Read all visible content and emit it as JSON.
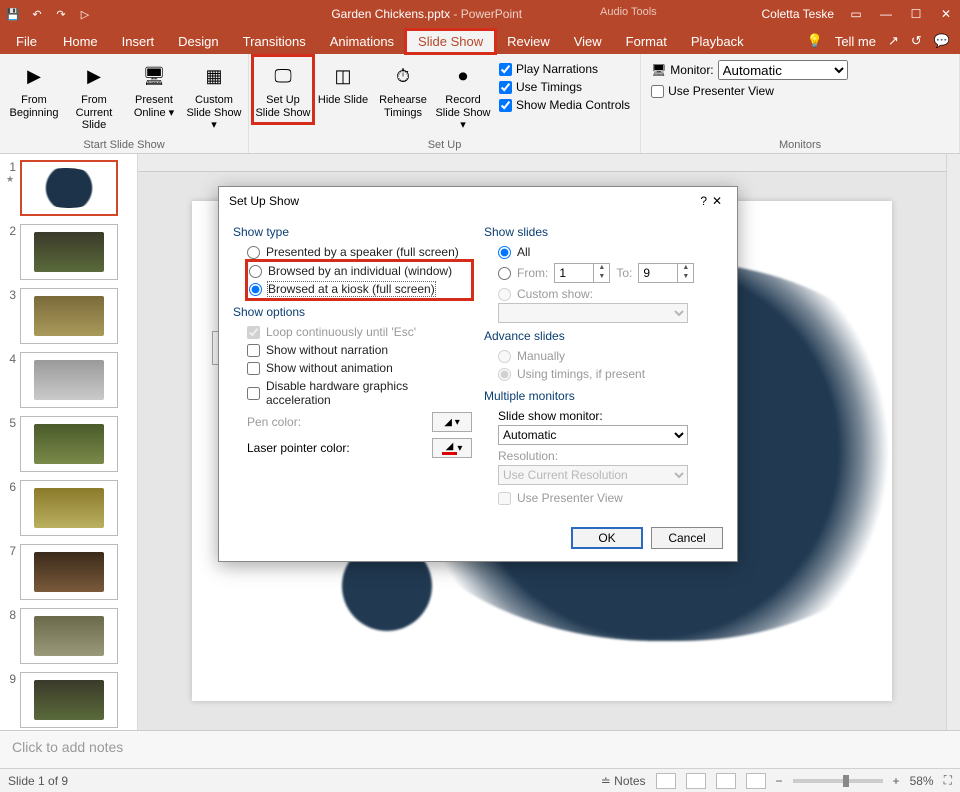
{
  "title": {
    "doc": "Garden Chickens.pptx",
    "app": "PowerPoint",
    "tools": "Audio Tools",
    "user": "Coletta Teske"
  },
  "tabs": [
    "File",
    "Home",
    "Insert",
    "Design",
    "Transitions",
    "Animations",
    "Slide Show",
    "Review",
    "View",
    "Format",
    "Playback"
  ],
  "active_tab": "Slide Show",
  "tell_me": "Tell me",
  "ribbon": {
    "start": {
      "label": "Start Slide Show",
      "from_beginning": "From Beginning",
      "from_current": "From Current Slide",
      "present_online": "Present Online",
      "custom": "Custom Slide Show"
    },
    "setup": {
      "label": "Set Up",
      "setup_show": "Set Up Slide Show",
      "hide": "Hide Slide",
      "rehearse": "Rehearse Timings",
      "record": "Record Slide Show",
      "play_narr": "Play Narrations",
      "use_timings": "Use Timings",
      "show_media": "Show Media Controls"
    },
    "monitors": {
      "label": "Monitors",
      "monitor": "Monitor:",
      "value": "Automatic",
      "presenter": "Use Presenter View"
    }
  },
  "dialog": {
    "title": "Set Up Show",
    "show_type": {
      "label": "Show type",
      "speaker": "Presented by a speaker (full screen)",
      "individual": "Browsed by an individual (window)",
      "kiosk": "Browsed at a kiosk (full screen)",
      "selected": "kiosk"
    },
    "show_options": {
      "label": "Show options",
      "loop": "Loop continuously until 'Esc'",
      "no_narr": "Show without narration",
      "no_anim": "Show without animation",
      "no_hw": "Disable hardware graphics acceleration",
      "pen": "Pen color:",
      "laser": "Laser pointer color:"
    },
    "show_slides": {
      "label": "Show slides",
      "all": "All",
      "from": "From:",
      "to": "To:",
      "from_val": "1",
      "to_val": "9",
      "custom": "Custom show:"
    },
    "advance": {
      "label": "Advance slides",
      "manual": "Manually",
      "timings": "Using timings, if present"
    },
    "multi": {
      "label": "Multiple monitors",
      "monitor": "Slide show monitor:",
      "monitor_val": "Automatic",
      "res": "Resolution:",
      "res_val": "Use Current Resolution",
      "presenter": "Use Presenter View"
    },
    "ok": "OK",
    "cancel": "Cancel"
  },
  "notes_placeholder": "Click to add notes",
  "status": {
    "slide": "Slide 1 of 9",
    "notes": "Notes",
    "zoom": "58%"
  },
  "thumbs": [
    1,
    2,
    3,
    4,
    5,
    6,
    7,
    8,
    9
  ]
}
